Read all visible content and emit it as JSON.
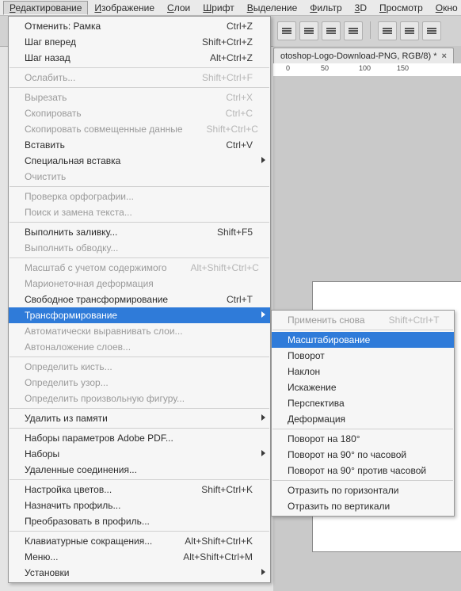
{
  "menubar": [
    {
      "label": "Редактирование",
      "ul": "Р",
      "active": true
    },
    {
      "label": "Изображение",
      "ul": "И"
    },
    {
      "label": "Слои",
      "ul": "С"
    },
    {
      "label": "Шрифт",
      "ul": "Ш"
    },
    {
      "label": "Выделение",
      "ul": "В"
    },
    {
      "label": "Фильтр",
      "ul": "Ф"
    },
    {
      "label": "3D",
      "ul": "3"
    },
    {
      "label": "Просмотр",
      "ul": "П"
    },
    {
      "label": "Окно",
      "ul": "О"
    }
  ],
  "doctab": {
    "title": "otoshop-Logo-Download-PNG, RGB/8) *"
  },
  "ruler_ticks": [
    "0",
    "50",
    "100",
    "150"
  ],
  "edit_menu": [
    {
      "t": "item",
      "label": "Отменить: Рамка",
      "sc": "Ctrl+Z"
    },
    {
      "t": "item",
      "label": "Шаг вперед",
      "sc": "Shift+Ctrl+Z"
    },
    {
      "t": "item",
      "label": "Шаг назад",
      "sc": "Alt+Ctrl+Z"
    },
    {
      "t": "sep"
    },
    {
      "t": "item",
      "label": "Ослабить...",
      "sc": "Shift+Ctrl+F",
      "disabled": true
    },
    {
      "t": "sep"
    },
    {
      "t": "item",
      "label": "Вырезать",
      "sc": "Ctrl+X",
      "disabled": true
    },
    {
      "t": "item",
      "label": "Скопировать",
      "sc": "Ctrl+C",
      "disabled": true
    },
    {
      "t": "item",
      "label": "Скопировать совмещенные данные",
      "sc": "Shift+Ctrl+C",
      "disabled": true
    },
    {
      "t": "item",
      "label": "Вставить",
      "sc": "Ctrl+V"
    },
    {
      "t": "item",
      "label": "Специальная вставка",
      "sub": true
    },
    {
      "t": "item",
      "label": "Очистить",
      "disabled": true
    },
    {
      "t": "sep"
    },
    {
      "t": "item",
      "label": "Проверка орфографии...",
      "disabled": true
    },
    {
      "t": "item",
      "label": "Поиск и замена текста...",
      "disabled": true
    },
    {
      "t": "sep"
    },
    {
      "t": "item",
      "label": "Выполнить заливку...",
      "sc": "Shift+F5"
    },
    {
      "t": "item",
      "label": "Выполнить обводку...",
      "disabled": true
    },
    {
      "t": "sep"
    },
    {
      "t": "item",
      "label": "Масштаб с учетом содержимого",
      "sc": "Alt+Shift+Ctrl+C",
      "disabled": true
    },
    {
      "t": "item",
      "label": "Марионеточная деформация",
      "disabled": true
    },
    {
      "t": "item",
      "label": "Свободное трансформирование",
      "sc": "Ctrl+T"
    },
    {
      "t": "item",
      "label": "Трансформирование",
      "sub": true,
      "hl": true
    },
    {
      "t": "item",
      "label": "Автоматически выравнивать слои...",
      "disabled": true
    },
    {
      "t": "item",
      "label": "Автоналожение слоев...",
      "disabled": true
    },
    {
      "t": "sep"
    },
    {
      "t": "item",
      "label": "Определить кисть...",
      "disabled": true
    },
    {
      "t": "item",
      "label": "Определить узор...",
      "disabled": true
    },
    {
      "t": "item",
      "label": "Определить произвольную фигуру...",
      "disabled": true
    },
    {
      "t": "sep"
    },
    {
      "t": "item",
      "label": "Удалить из памяти",
      "sub": true
    },
    {
      "t": "sep"
    },
    {
      "t": "item",
      "label": "Наборы параметров Adobe PDF..."
    },
    {
      "t": "item",
      "label": "Наборы",
      "sub": true
    },
    {
      "t": "item",
      "label": "Удаленные соединения..."
    },
    {
      "t": "sep"
    },
    {
      "t": "item",
      "label": "Настройка цветов...",
      "sc": "Shift+Ctrl+K"
    },
    {
      "t": "item",
      "label": "Назначить профиль..."
    },
    {
      "t": "item",
      "label": "Преобразовать в профиль..."
    },
    {
      "t": "sep"
    },
    {
      "t": "item",
      "label": "Клавиатурные сокращения...",
      "sc": "Alt+Shift+Ctrl+K"
    },
    {
      "t": "item",
      "label": "Меню...",
      "sc": "Alt+Shift+Ctrl+M"
    },
    {
      "t": "item",
      "label": "Установки",
      "sub": true
    }
  ],
  "transform_menu": [
    {
      "t": "item",
      "label": "Применить снова",
      "sc": "Shift+Ctrl+T",
      "disabled": true
    },
    {
      "t": "sep"
    },
    {
      "t": "item",
      "label": "Масштабирование",
      "hl": true
    },
    {
      "t": "item",
      "label": "Поворот"
    },
    {
      "t": "item",
      "label": "Наклон"
    },
    {
      "t": "item",
      "label": "Искажение"
    },
    {
      "t": "item",
      "label": "Перспектива"
    },
    {
      "t": "item",
      "label": "Деформация"
    },
    {
      "t": "sep"
    },
    {
      "t": "item",
      "label": "Поворот на 180°"
    },
    {
      "t": "item",
      "label": "Поворот на 90° по часовой"
    },
    {
      "t": "item",
      "label": "Поворот на 90° против часовой"
    },
    {
      "t": "sep"
    },
    {
      "t": "item",
      "label": "Отразить по горизонтали"
    },
    {
      "t": "item",
      "label": "Отразить по вертикали"
    }
  ]
}
